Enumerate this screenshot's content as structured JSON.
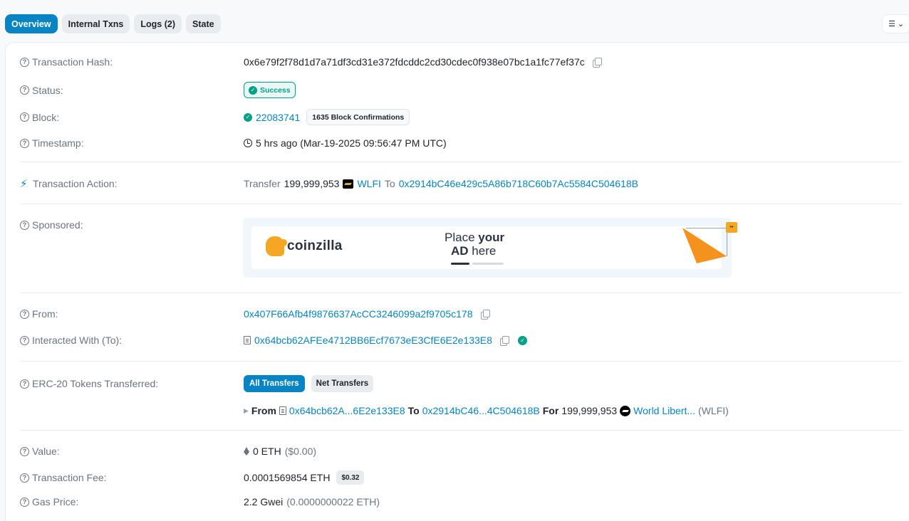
{
  "tabs": [
    {
      "label": "Overview",
      "active": true
    },
    {
      "label": "Internal Txns"
    },
    {
      "label": "Logs (2)"
    },
    {
      "label": "State"
    }
  ],
  "labels": {
    "tx_hash": "Transaction Hash:",
    "status": "Status:",
    "block": "Block:",
    "timestamp": "Timestamp:",
    "tx_action": "Transaction Action:",
    "sponsored": "Sponsored:",
    "from": "From:",
    "interacted": "Interacted With (To):",
    "erc20": "ERC-20 Tokens Transferred:",
    "value": "Value:",
    "fee": "Transaction Fee:",
    "gas": "Gas Price:"
  },
  "tx_hash": "0x6e79f2f78d1d7a71df3cd31e372fdcddc2cd30cdec0f938e07bc1a1fc77ef37c",
  "status": "Success",
  "block": {
    "number": "22083741",
    "confirmations": "1635 Block Confirmations"
  },
  "timestamp": "5 hrs ago (Mar-19-2025 09:56:47 PM UTC)",
  "action": {
    "verb": "Transfer",
    "amount": "199,999,953",
    "token": "WLFI",
    "to_word": "To",
    "to_address": "0x2914bC46e429c5A86b718C60b7Ac5584C504618B"
  },
  "ad": {
    "brand": "coinzilla",
    "line1_light": "Place ",
    "line1_bold": "your",
    "line2_bold": "AD",
    "line2_light": " here"
  },
  "from_address": "0x407F66Afb4f9876637AcCC3246099a2f9705c178",
  "to_contract": "0x64bcb62AFEe4712BB6Ecf7673eE3CfE6E2e133E8",
  "erc20": {
    "btn_all": "All Transfers",
    "btn_net": "Net Transfers",
    "from_word": "From",
    "from_addr": "0x64bcb62A...6E2e133E8",
    "to_word": "To",
    "to_addr": "0x2914bC46...4C504618B",
    "for_word": "For",
    "amount": "199,999,953",
    "token_name": "World Libert...",
    "token_symbol": "(WLFI)"
  },
  "value": {
    "eth": "0 ETH",
    "usd": "($0.00)"
  },
  "fee": {
    "eth": "0.0001569854 ETH",
    "usd": "$0.32"
  },
  "gas": {
    "gwei": "2.2 Gwei",
    "eth": "(0.0000000022 ETH)"
  },
  "colors": {
    "accent": "#0784c3",
    "success": "#00a186"
  },
  "icons": [
    "question-icon",
    "copy-icon",
    "check-circle-icon",
    "clock-icon",
    "lightning-icon",
    "document-icon",
    "eth-icon",
    "list-icon",
    "chevron-down-icon",
    "caret-right-icon"
  ]
}
